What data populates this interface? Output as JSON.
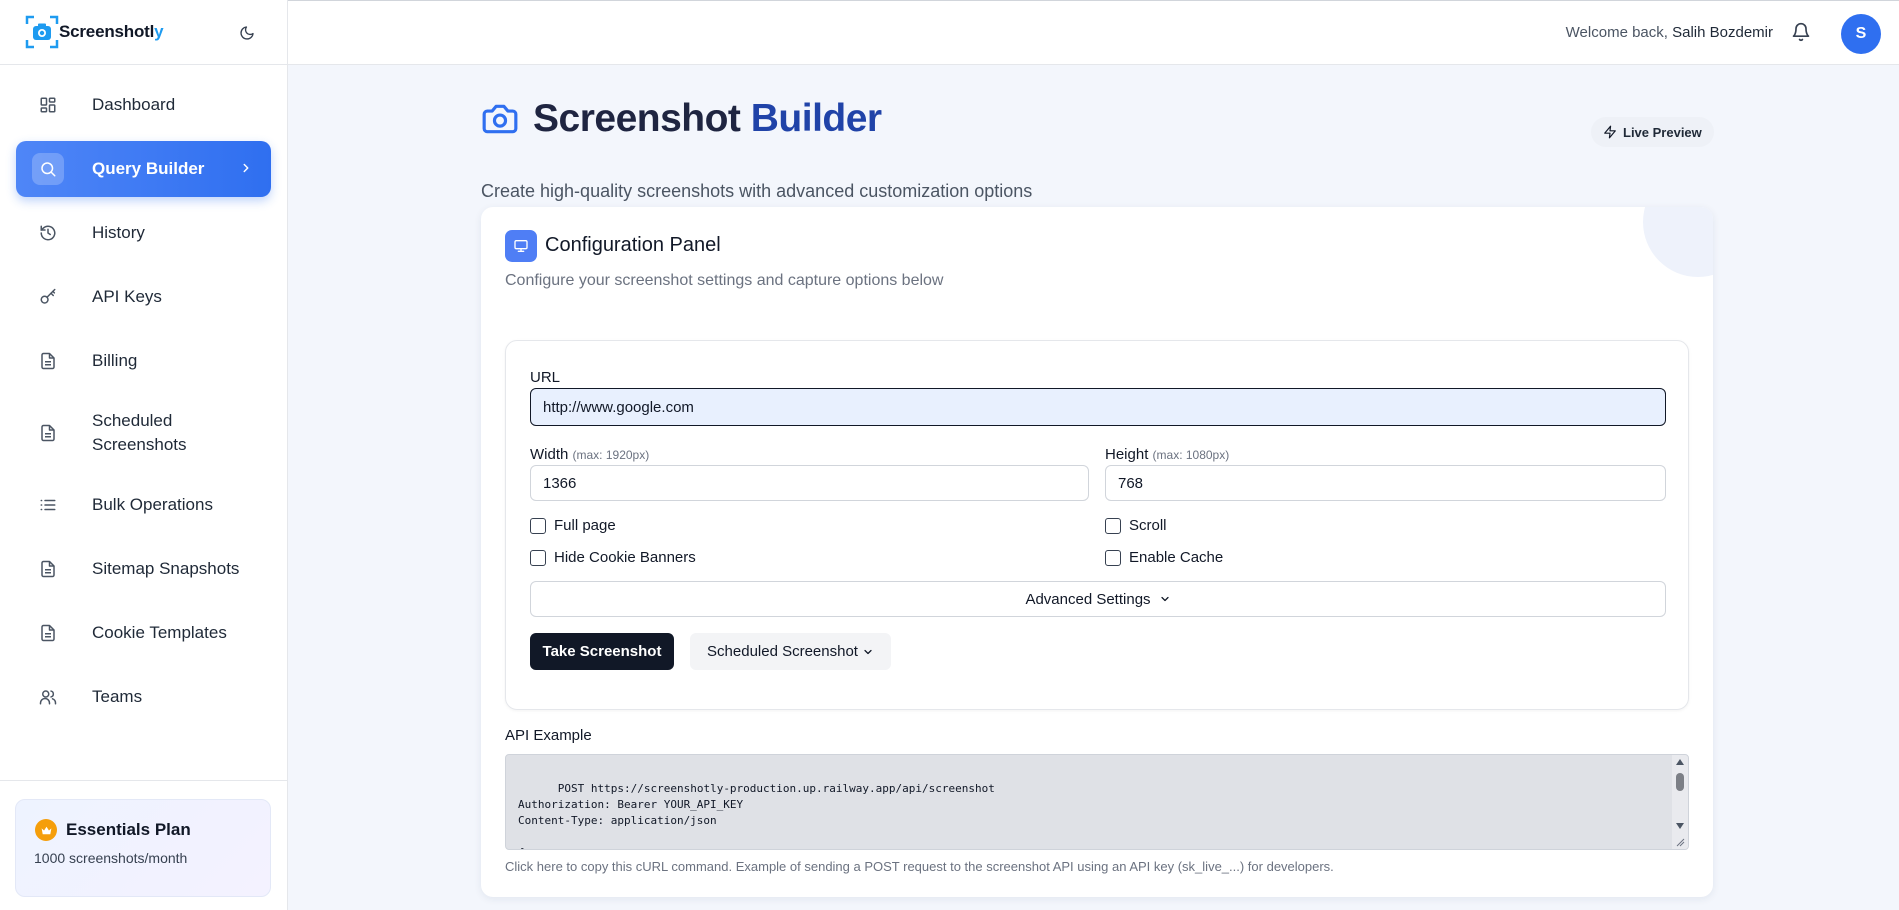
{
  "brand": {
    "name_main": "Screenshotl",
    "name_accent": "y"
  },
  "sidebar": {
    "items": [
      {
        "label": "Dashboard",
        "icon": "dashboard-icon"
      },
      {
        "label": "Query Builder",
        "icon": "search-icon",
        "active": true
      },
      {
        "label": "History",
        "icon": "history-icon"
      },
      {
        "label": "API Keys",
        "icon": "key-icon"
      },
      {
        "label": "Billing",
        "icon": "document-icon"
      },
      {
        "label": "Scheduled\nScreenshots",
        "icon": "document-icon"
      },
      {
        "label": "Bulk Operations",
        "icon": "list-icon"
      },
      {
        "label": "Sitemap Snapshots",
        "icon": "document-icon"
      },
      {
        "label": "Cookie Templates",
        "icon": "document-icon"
      },
      {
        "label": "Teams",
        "icon": "users-icon"
      }
    ],
    "plan": {
      "title": "Essentials Plan",
      "subtitle": "1000 screenshots/month"
    }
  },
  "topbar": {
    "welcome_prefix": "Welcome back, ",
    "user_name": "Salih Bozdemir",
    "avatar_initial": "S"
  },
  "page": {
    "title_part1": "Screenshot ",
    "title_part2": "Builder",
    "subtitle": "Create high-quality screenshots with advanced customization options",
    "live_preview": "Live Preview"
  },
  "panel": {
    "title": "Configuration Panel",
    "subtitle": "Configure your screenshot settings and capture options below",
    "url_label": "URL",
    "url_value": "http://www.google.com",
    "width_label": "Width",
    "width_hint": "(max: 1920px)",
    "width_value": "1366",
    "height_label": "Height",
    "height_hint": "(max: 1080px)",
    "height_value": "768",
    "checkboxes": {
      "full_page": "Full page",
      "scroll": "Scroll",
      "hide_cookie": "Hide Cookie Banners",
      "enable_cache": "Enable Cache"
    },
    "advanced": "Advanced Settings",
    "take_screenshot": "Take Screenshot",
    "scheduled_screenshot": "Scheduled Screenshot",
    "api_label": "API Example",
    "api_code": "POST https://screenshotly-production.up.railway.app/api/screenshot\nAuthorization: Bearer YOUR_API_KEY\nContent-Type: application/json\n\n{\n  \"url\": \"http://www.google.com\",",
    "api_note": "Click here to copy this cURL command. Example of sending a POST request to the screenshot API using an API key (sk_live_...) for developers."
  },
  "colors": {
    "accent": "#2f6ff0",
    "title_blue": "#2043a8",
    "dark_button": "#111827"
  }
}
